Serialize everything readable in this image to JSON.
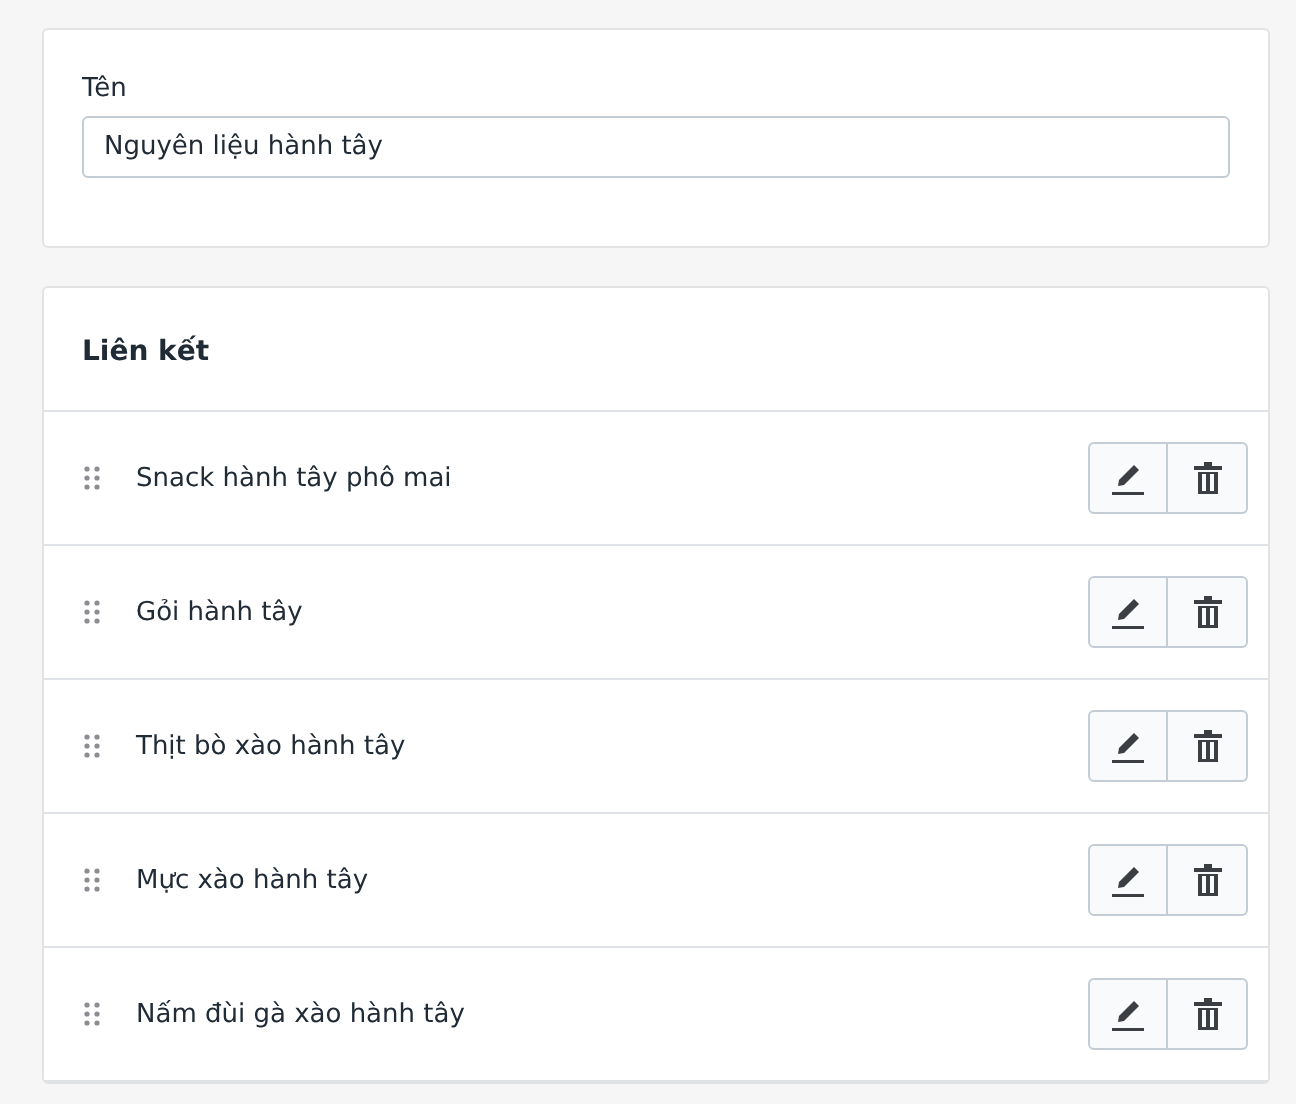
{
  "name_field": {
    "label": "Tên",
    "value": "Nguyên liệu hành tây"
  },
  "links": {
    "title": "Liên kết",
    "items": [
      {
        "name": "Snack hành tây phô mai"
      },
      {
        "name": "Gỏi hành tây"
      },
      {
        "name": "Thịt bò xào hành tây"
      },
      {
        "name": "Mực xào hành tây"
      },
      {
        "name": "Nấm đùi gà xào hành tây"
      }
    ]
  }
}
